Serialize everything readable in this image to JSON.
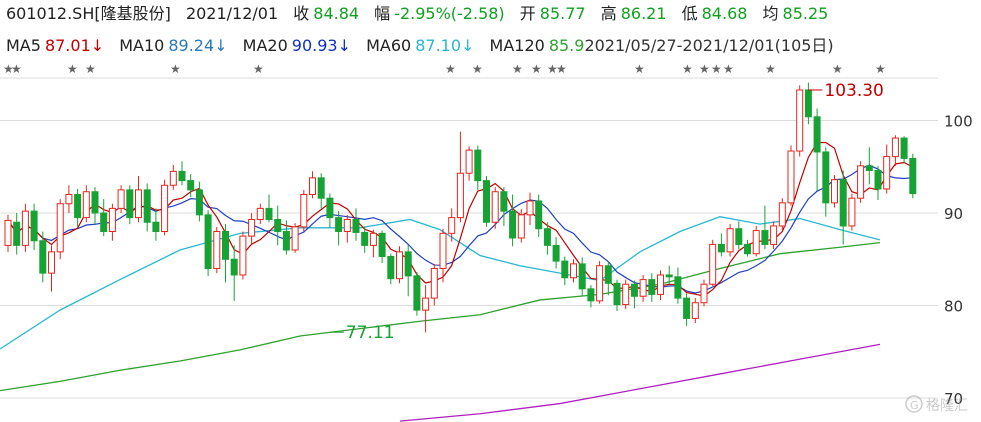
{
  "header": {
    "code": "601012.SH[隆基股份]",
    "date": "2021/12/01",
    "close_label": "收",
    "close": "84.84",
    "chg_label": "幅",
    "chg": "-2.95%(-2.58)",
    "open_label": "开",
    "open": "85.77",
    "high_label": "高",
    "high": "86.21",
    "low_label": "低",
    "low": "84.68",
    "avg_label": "均",
    "avg": "85.25"
  },
  "ma_bar": {
    "ma5_label": "MA5",
    "ma5": "87.01↓",
    "ma10_label": "MA10",
    "ma10": "89.24↓",
    "ma20_label": "MA20",
    "ma20": "90.93↓",
    "ma60_label": "MA60",
    "ma60": "87.10↓",
    "ma120_label": "MA120",
    "ma120": "85.9",
    "range": "2021/05/27-2021/12/01(105日)"
  },
  "colors": {
    "up": "#e8251d",
    "down": "#17a234",
    "ma5": "#c00000",
    "ma10": "#2040c0",
    "ma20": "#29b8d0",
    "ma60": "#30a030",
    "ma120": "#b020c0",
    "grid": "#dddddd"
  },
  "chart_data": {
    "type": "candlestick",
    "y_ticks": [
      100,
      90,
      80,
      70
    ],
    "ylim": [
      69,
      107
    ],
    "annotations": [
      {
        "label": "103.30",
        "value": 103.3,
        "color": "#c00000"
      },
      {
        "label": "77.11",
        "value": 77.11,
        "color": "#17a234"
      }
    ],
    "candles": [
      [
        86.5,
        89.2,
        89.8,
        85.8
      ],
      [
        89,
        86.5,
        90,
        85.5
      ],
      [
        86.5,
        90.2,
        91,
        85.8
      ],
      [
        90.2,
        87,
        91,
        86
      ],
      [
        87,
        83.5,
        88,
        82.5
      ],
      [
        83.5,
        85.8,
        86.5,
        81.5
      ],
      [
        85.8,
        91,
        91.5,
        85
      ],
      [
        91,
        92,
        93,
        90
      ],
      [
        92,
        89.5,
        92.6,
        88.5
      ],
      [
        89.5,
        92.3,
        93,
        89
      ],
      [
        92.3,
        90,
        92.8,
        88.8
      ],
      [
        90,
        88,
        91.5,
        87.5
      ],
      [
        88,
        90.5,
        91,
        87
      ],
      [
        90.5,
        92.5,
        93,
        90
      ],
      [
        92.5,
        89.5,
        93,
        88.8
      ],
      [
        89.5,
        92.5,
        94,
        89
      ],
      [
        92.5,
        89,
        93.2,
        88
      ],
      [
        89,
        88,
        90.5,
        87
      ],
      [
        88,
        93,
        93.6,
        87.6
      ],
      [
        93,
        94.5,
        95.2,
        92.5
      ],
      [
        94.5,
        93.5,
        95.6,
        93
      ],
      [
        93.5,
        92.5,
        94.2,
        91.7
      ],
      [
        92.5,
        89.8,
        93.4,
        89.1
      ],
      [
        89.8,
        84,
        90.3,
        83.2
      ],
      [
        84,
        88,
        88.5,
        83.5
      ],
      [
        88,
        85,
        88.8,
        82.5
      ],
      [
        85,
        83.3,
        86.5,
        80.5
      ],
      [
        83.3,
        87.5,
        88,
        82.8
      ],
      [
        87.5,
        89.3,
        90,
        86.6
      ],
      [
        89.3,
        90.5,
        91,
        88.8
      ],
      [
        90.5,
        89.3,
        92,
        89
      ],
      [
        89.3,
        88,
        90.8,
        86.5
      ],
      [
        88,
        86,
        89.2,
        85.5
      ],
      [
        86,
        88.5,
        88.9,
        85.7
      ],
      [
        88.5,
        92,
        92.5,
        88
      ],
      [
        92,
        93.8,
        94.5,
        91.6
      ],
      [
        93.8,
        91.6,
        94.3,
        90.5
      ],
      [
        91.6,
        89.5,
        92.1,
        88.4
      ],
      [
        89.5,
        88,
        90.2,
        86.5
      ],
      [
        88,
        89.3,
        89.8,
        86.8
      ],
      [
        89.3,
        87.9,
        90.5,
        87
      ],
      [
        87.9,
        86.5,
        88.5,
        85.7
      ],
      [
        86.5,
        87.8,
        88.2,
        85.2
      ],
      [
        87.8,
        85.3,
        88.1,
        84.6
      ],
      [
        85.3,
        82.9,
        85.6,
        82.3
      ],
      [
        82.9,
        85.8,
        86.4,
        82.4
      ],
      [
        85.8,
        83.2,
        86.6,
        81
      ],
      [
        83.2,
        79.5,
        83.6,
        78.9
      ],
      [
        79.5,
        80.8,
        82.2,
        77.1
      ],
      [
        80.8,
        84,
        84.5,
        80
      ],
      [
        84,
        87.8,
        88.3,
        82.5
      ],
      [
        87.8,
        89.5,
        90.5,
        86.9
      ],
      [
        89.5,
        94.3,
        98.8,
        89
      ],
      [
        94.3,
        96.8,
        97.2,
        93.5
      ],
      [
        96.8,
        93.5,
        97.3,
        92.5
      ],
      [
        93.5,
        89,
        94,
        88.5
      ],
      [
        89,
        92.3,
        92.8,
        88.3
      ],
      [
        92.3,
        90.2,
        92.8,
        88.6
      ],
      [
        90.2,
        87.3,
        92,
        86.4
      ],
      [
        87.3,
        89.8,
        90.4,
        86.8
      ],
      [
        89.8,
        91.3,
        92.2,
        88.7
      ],
      [
        91.3,
        88.3,
        92,
        87.4
      ],
      [
        88.3,
        86.5,
        89,
        85.5
      ],
      [
        86.5,
        84.8,
        87.4,
        84
      ],
      [
        84.8,
        83,
        85.3,
        82.2
      ],
      [
        83,
        84.5,
        85,
        82.5
      ],
      [
        84.5,
        81.8,
        85.2,
        81
      ],
      [
        81.8,
        80.5,
        82.2,
        79.8
      ],
      [
        80.5,
        84.3,
        84.8,
        80.2
      ],
      [
        84.3,
        82.4,
        84.8,
        81.1
      ],
      [
        82.4,
        80.1,
        82.8,
        79.4
      ],
      [
        80.1,
        82.3,
        82.8,
        79.6
      ],
      [
        82.3,
        81,
        82.7,
        79.7
      ],
      [
        81,
        82.8,
        83.3,
        80.4
      ],
      [
        82.8,
        81.2,
        83.5,
        80.4
      ],
      [
        81.2,
        83.3,
        83.8,
        80.6
      ],
      [
        83.3,
        83.1,
        84.3,
        82.3
      ],
      [
        83.1,
        80.8,
        84.1,
        80.2
      ],
      [
        80.8,
        78.6,
        81.3,
        77.8
      ],
      [
        78.6,
        80.3,
        80.8,
        78.1
      ],
      [
        80.3,
        82.3,
        82.8,
        79.9
      ],
      [
        82.3,
        86.6,
        87.1,
        82.1
      ],
      [
        86.6,
        85.8,
        87.8,
        85.3
      ],
      [
        85.8,
        88.3,
        88.8,
        85.3
      ],
      [
        88.3,
        86.6,
        89.1,
        86.1
      ],
      [
        86.6,
        85.6,
        87.1,
        85.3
      ],
      [
        85.6,
        88.1,
        88.6,
        85.3
      ],
      [
        88.1,
        86.6,
        90.8,
        86.1
      ],
      [
        86.6,
        88.6,
        89.1,
        86.1
      ],
      [
        88.6,
        91.1,
        91.6,
        88.1
      ],
      [
        91.1,
        96.7,
        97.3,
        90.8
      ],
      [
        96.7,
        103.3,
        103.8,
        96.1
      ],
      [
        103.3,
        100.4,
        104.1,
        99.6
      ],
      [
        100.4,
        96.6,
        101.3,
        92.4
      ],
      [
        96.6,
        91.1,
        97.1,
        89.6
      ],
      [
        91.1,
        93.6,
        94.1,
        90.6
      ],
      [
        93.6,
        88.6,
        94.6,
        86.6
      ],
      [
        88.6,
        91.6,
        92.1,
        88.1
      ],
      [
        91.6,
        95.1,
        95.6,
        91.1
      ],
      [
        95.1,
        94.6,
        97.1,
        93.1
      ],
      [
        94.6,
        92.6,
        95.1,
        91.4
      ],
      [
        92.6,
        96.1,
        97.4,
        92.1
      ],
      [
        96.1,
        98.1,
        98.4,
        95.1
      ],
      [
        98.1,
        95.9,
        98.3,
        95.4
      ],
      [
        95.9,
        92.1,
        96.4,
        91.6
      ]
    ],
    "ma60": [
      [
        0,
        70.8
      ],
      [
        60,
        71.8
      ],
      [
        120,
        73
      ],
      [
        180,
        74
      ],
      [
        240,
        75.2
      ],
      [
        300,
        76.7
      ],
      [
        360,
        77.5
      ],
      [
        420,
        78.3
      ],
      [
        480,
        79
      ],
      [
        540,
        80.6
      ],
      [
        600,
        81.2
      ],
      [
        660,
        82.3
      ],
      [
        720,
        84
      ],
      [
        780,
        85.6
      ],
      [
        840,
        86.3
      ],
      [
        880,
        86.8
      ]
    ],
    "ma120": [
      [
        400,
        67.5
      ],
      [
        480,
        68.3
      ],
      [
        560,
        69.4
      ],
      [
        640,
        71
      ],
      [
        720,
        72.6
      ],
      [
        800,
        74.2
      ],
      [
        880,
        75.8
      ]
    ],
    "ma20": [
      [
        0,
        75.3
      ],
      [
        60,
        79.5
      ],
      [
        120,
        82.8
      ],
      [
        180,
        86
      ],
      [
        240,
        87.8
      ],
      [
        300,
        88.4
      ],
      [
        360,
        88.4
      ],
      [
        410,
        89.3
      ],
      [
        440,
        88.2
      ],
      [
        480,
        85.4
      ],
      [
        520,
        84.3
      ],
      [
        560,
        83.5
      ],
      [
        600,
        82.7
      ],
      [
        640,
        85.8
      ],
      [
        680,
        88
      ],
      [
        720,
        89.6
      ],
      [
        760,
        88.8
      ],
      [
        800,
        89.4
      ],
      [
        840,
        88.2
      ],
      [
        880,
        87.1
      ]
    ]
  }
}
